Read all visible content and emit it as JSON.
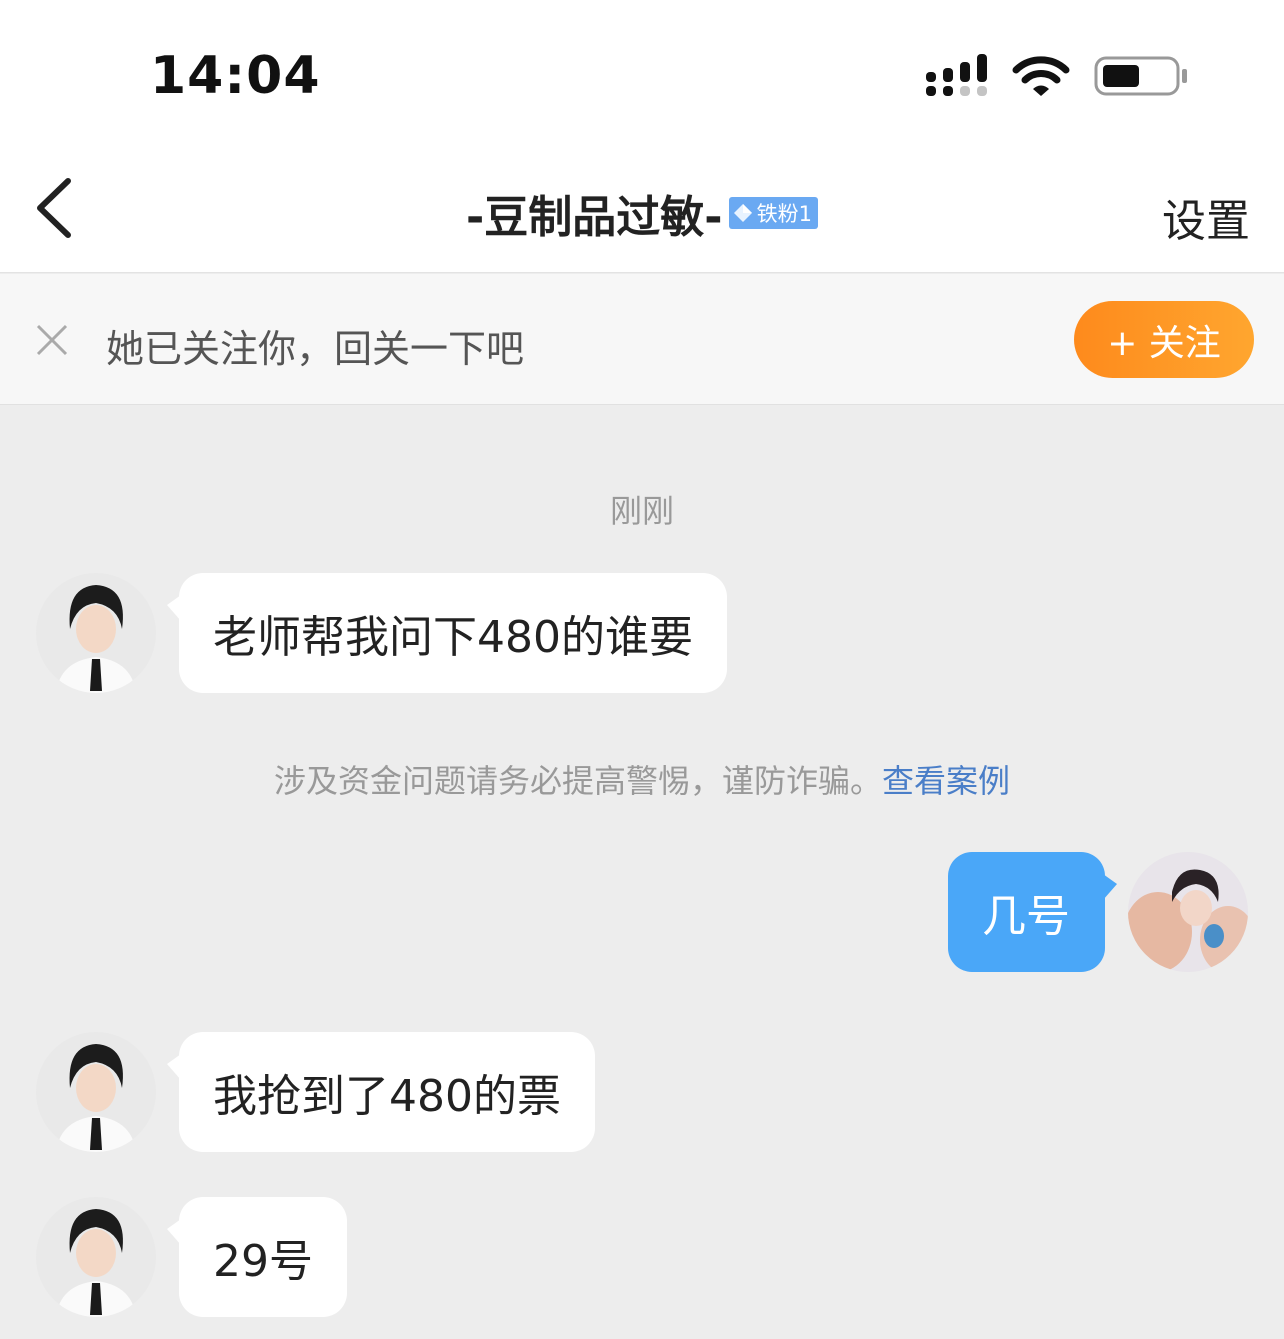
{
  "status_bar": {
    "time": "14:04"
  },
  "nav": {
    "title": "-豆制品过敏-",
    "badge": "铁粉1",
    "settings": "设置"
  },
  "follow_banner": {
    "text": "她已关注你，回关一下吧",
    "button": "+ 关注"
  },
  "chat": {
    "time_divider": "刚刚",
    "messages": [
      {
        "side": "in",
        "text": "老师帮我问下480的谁要"
      },
      {
        "side": "out",
        "text": "几号"
      },
      {
        "side": "in",
        "text": "我抢到了480的票"
      },
      {
        "side": "in",
        "text": "29号"
      }
    ],
    "warning": {
      "text": "涉及资金问题请务必提高警惕，谨防诈骗。",
      "link": "查看案例"
    }
  },
  "colors": {
    "accent_blue": "#4aa7f8",
    "follow_orange": "#fe8a1c",
    "link_blue": "#4a7ec8"
  }
}
